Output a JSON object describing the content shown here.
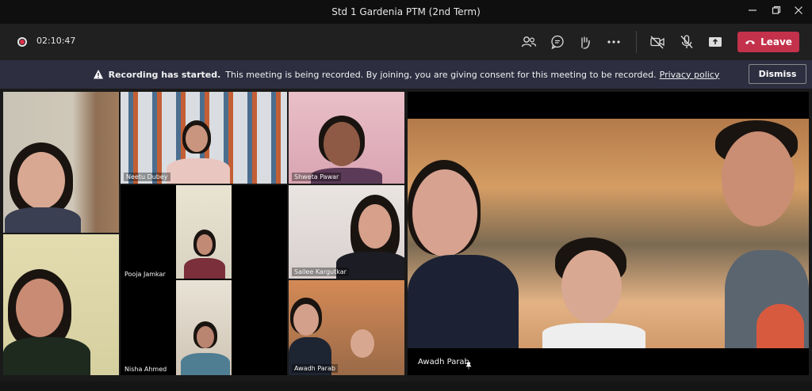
{
  "window": {
    "title": "Std 1 Gardenia PTM (2nd Term)"
  },
  "toolbar": {
    "timer": "02:10:47",
    "leave_label": "Leave",
    "icons": [
      "people-icon",
      "chat-icon",
      "raise-hand-icon",
      "more-options-icon",
      "camera-off-icon",
      "mic-off-icon",
      "share-screen-icon"
    ]
  },
  "banner": {
    "title": "Recording has started.",
    "message": "This meeting is being recorded. By joining, you are giving consent for this meeting to be recorded.",
    "link": "Privacy policy",
    "dismiss_label": "Dismiss"
  },
  "participants": [
    {
      "name": ""
    },
    {
      "name": "Neetu Dubey"
    },
    {
      "name": "Shweta Pawar"
    },
    {
      "name": ""
    },
    {
      "name": "Pooja Jamkar"
    },
    {
      "name": "Nisha Ahmed"
    },
    {
      "name": "Sallee Kargutkar"
    },
    {
      "name": "Awadh Parab"
    }
  ],
  "spotlight": {
    "name": "Awadh Parab"
  },
  "colors": {
    "leave": "#c4314b",
    "banner": "#2d2e40",
    "accent": "#e0324a"
  }
}
